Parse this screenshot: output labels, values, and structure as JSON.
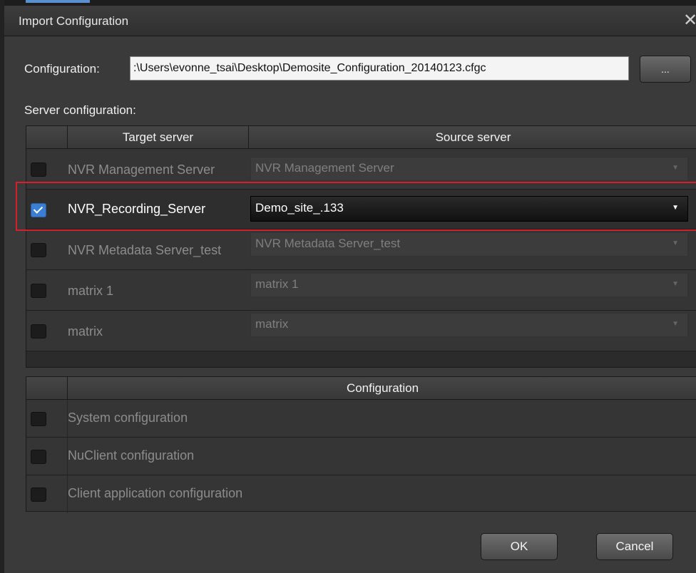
{
  "window": {
    "title": "Import Configuration"
  },
  "config": {
    "label": "Configuration:",
    "path": ":\\Users\\evonne_tsai\\Desktop\\Demosite_Configuration_20140123.cfgc",
    "browse_label": "..."
  },
  "server_config": {
    "label": "Server configuration:",
    "columns": [
      "Target server",
      "Source server"
    ],
    "rows": [
      {
        "target": "NVR Management Server",
        "source": "NVR Management Server",
        "checked": false
      },
      {
        "target": "NVR_Recording_Server",
        "source": "Demo_site_.133",
        "checked": true
      },
      {
        "target": "NVR Metadata Server_test",
        "source": "NVR Metadata Server_test",
        "checked": false
      },
      {
        "target": "matrix 1",
        "source": "matrix 1",
        "checked": false
      },
      {
        "target": "matrix",
        "source": "matrix",
        "checked": false
      }
    ]
  },
  "configuration": {
    "header": "Configuration",
    "items": [
      {
        "label": "System configuration",
        "checked": false
      },
      {
        "label": "NuClient configuration",
        "checked": false
      },
      {
        "label": "Client application configuration",
        "checked": false
      }
    ]
  },
  "buttons": {
    "ok": "OK",
    "cancel": "Cancel"
  },
  "colors": {
    "highlight": "#d81e2b",
    "check_accent": "#3a7fd4"
  }
}
